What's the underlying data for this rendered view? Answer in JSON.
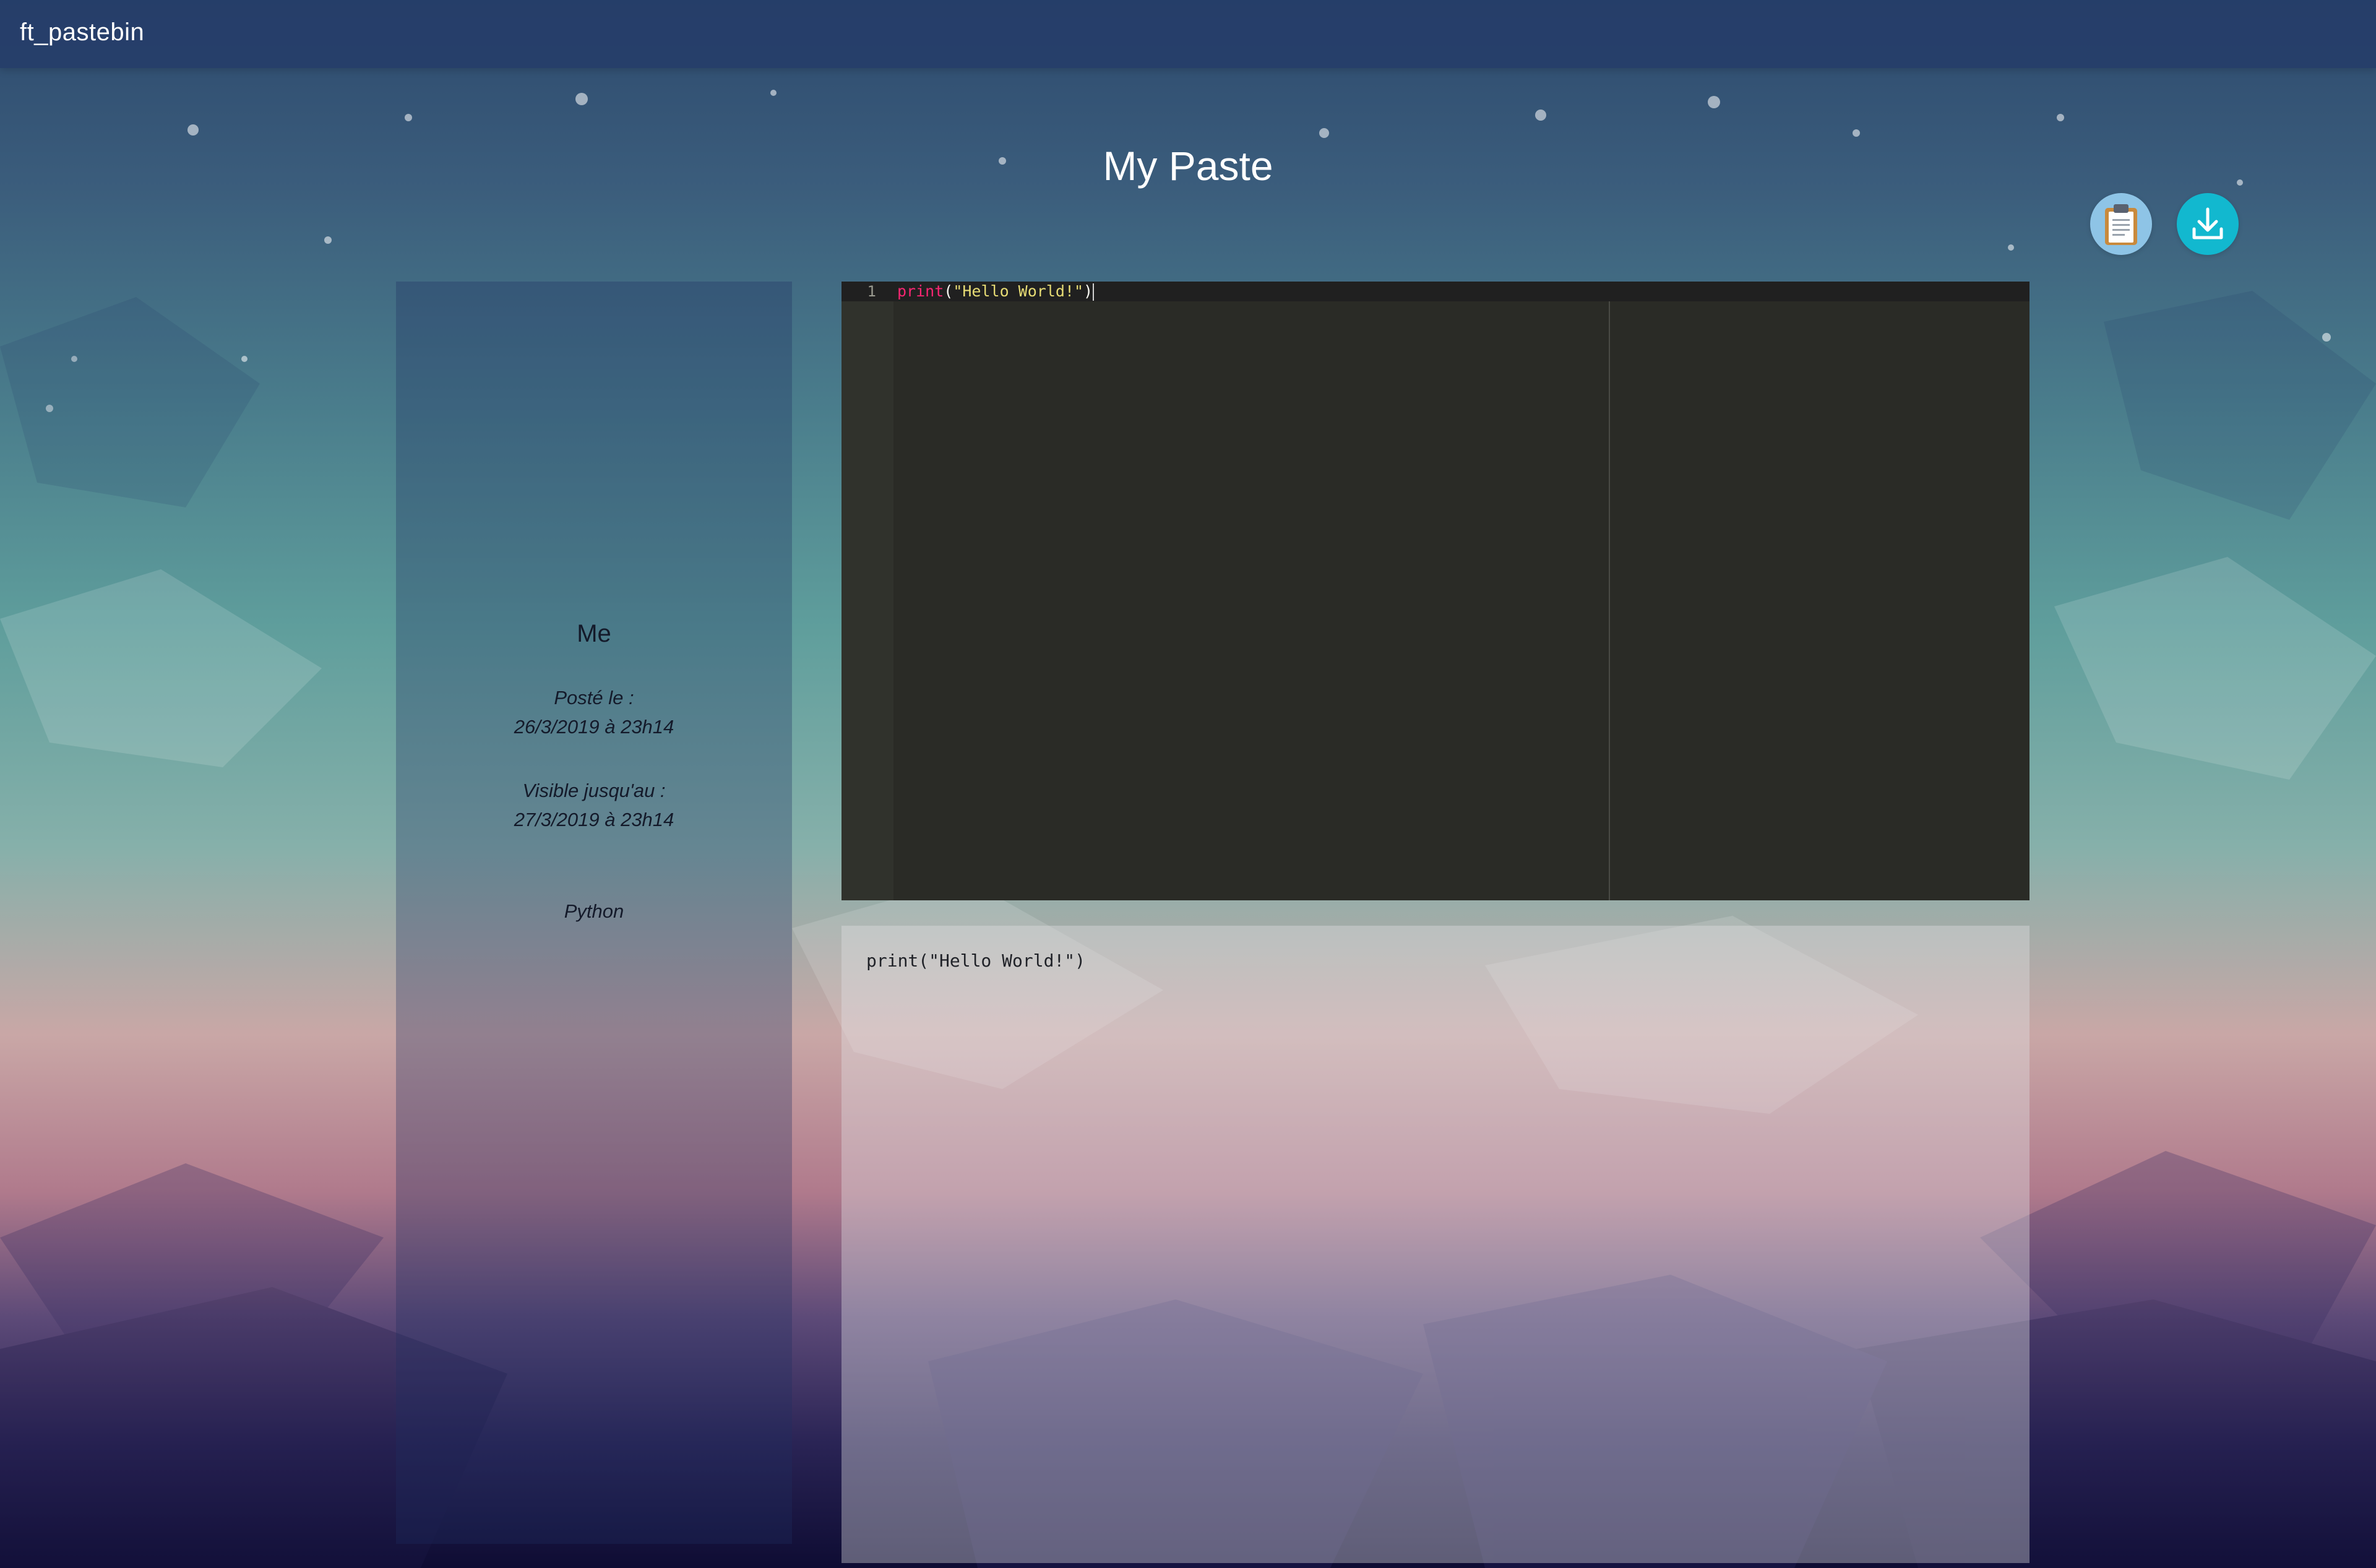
{
  "app": {
    "brand": "ft_pastebin"
  },
  "page": {
    "title": "My Paste"
  },
  "actions": {
    "copy_icon": "clipboard-icon",
    "download_icon": "download-icon"
  },
  "info": {
    "author": "Me",
    "posted_label": "Posté le :",
    "posted_value": "26/3/2019 à 23h14",
    "visible_label": "Visible jusqu'au :",
    "visible_value": "27/3/2019 à 23h14",
    "language": "Python"
  },
  "editor": {
    "line_number": "1",
    "tokens": {
      "fn": "print",
      "open": "(",
      "str": "\"Hello World!\"",
      "close": ")"
    }
  },
  "preview": {
    "code": "print(\"Hello World!\")"
  },
  "colors": {
    "accent": "#12b8cf",
    "copy_button": "#8ec4e6",
    "editor_bg": "#2a2b26"
  }
}
